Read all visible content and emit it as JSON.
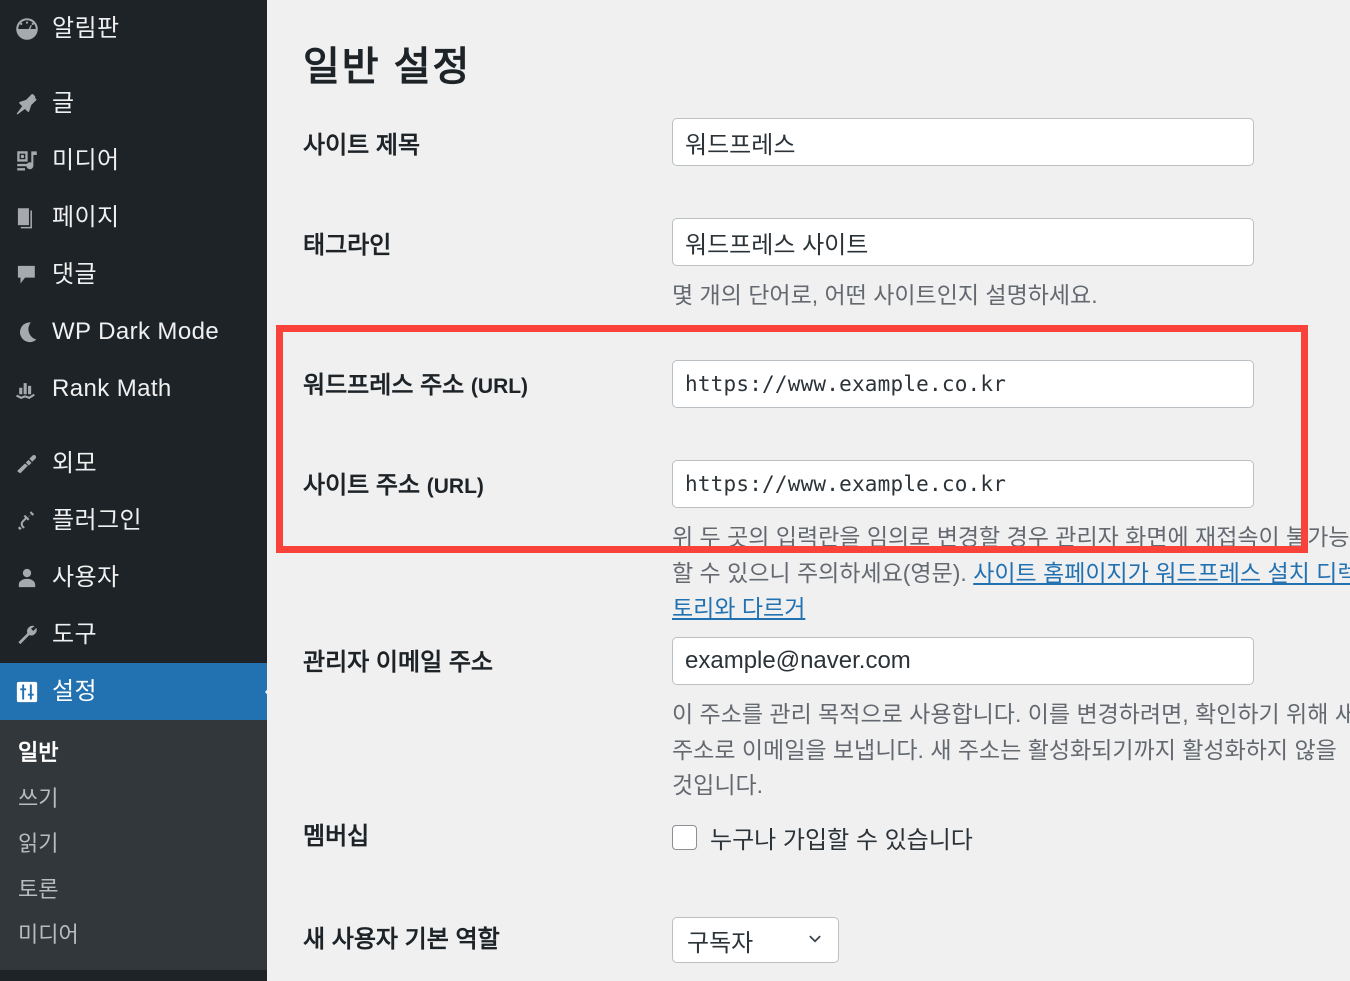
{
  "colors": {
    "sidebar_bg": "#1d2327",
    "submenu_bg": "#32373c",
    "accent_blue": "#2271b1",
    "link_blue": "#2271b1",
    "content_bg": "#f0f0f1",
    "annotation_red": "#f9423a",
    "text_dark": "#1d2327",
    "text_muted": "#646970"
  },
  "sidebar": {
    "items": [
      {
        "label": "알림판",
        "icon": "dashboard-icon",
        "current": false
      },
      {
        "label": "글",
        "icon": "pin-icon",
        "current": false
      },
      {
        "label": "미디어",
        "icon": "media-icon",
        "current": false
      },
      {
        "label": "페이지",
        "icon": "pages-icon",
        "current": false
      },
      {
        "label": "댓글",
        "icon": "comment-icon",
        "current": false
      },
      {
        "label": "WP Dark Mode",
        "icon": "moon-icon",
        "current": false
      },
      {
        "label": "Rank Math",
        "icon": "chart-bars-icon",
        "current": false
      },
      {
        "label": "외모",
        "icon": "paintbrush-icon",
        "current": false
      },
      {
        "label": "플러그인",
        "icon": "plug-icon",
        "current": false
      },
      {
        "label": "사용자",
        "icon": "user-icon",
        "current": false
      },
      {
        "label": "도구",
        "icon": "wrench-icon",
        "current": false
      },
      {
        "label": "설정",
        "icon": "settings-sliders-icon",
        "current": true
      }
    ],
    "submenu": [
      {
        "label": "일반",
        "current": true
      },
      {
        "label": "쓰기",
        "current": false
      },
      {
        "label": "읽기",
        "current": false
      },
      {
        "label": "토론",
        "current": false
      },
      {
        "label": "미디어",
        "current": false
      }
    ]
  },
  "page": {
    "title": "일반 설정"
  },
  "fields": {
    "site_title": {
      "label": "사이트 제목",
      "value": "워드프레스"
    },
    "tagline": {
      "label": "태그라인",
      "value": "워드프레스 사이트",
      "description": "몇 개의 단어로, 어떤 사이트인지 설명하세요."
    },
    "wp_address": {
      "label_main": "워드프레스 주소",
      "label_suffix": "(URL)",
      "value": "https://www.example.co.kr"
    },
    "site_address": {
      "label_main": "사이트 주소",
      "label_suffix": "(URL)",
      "value": "https://www.example.co.kr",
      "description_text": "위 두 곳의 입력란을 임의로 변경할 경우 관리자 화면에 재접속이 불가능할 수 있으니 주의하세요(영문). ",
      "description_link": "사이트 홈페이지가 워드프레스 설치 디렉토리와 다르거"
    },
    "admin_email": {
      "label": "관리자 이메일 주소",
      "value": "example@naver.com",
      "description": "이 주소를 관리 목적으로 사용합니다. 이를 변경하려면, 확인하기 위해 새 주소로 이메일을 보냅니다. 새 주소는 활성화되기까지 활성화하지 않을 것입니다."
    },
    "membership": {
      "label": "멤버십",
      "checkbox_label": "누구나 가입할 수 있습니다",
      "checked": false
    },
    "default_role": {
      "label": "새 사용자 기본 역할",
      "value": "구독자",
      "options": [
        "구독자"
      ]
    }
  },
  "annotation": {
    "kind": "red-highlight-rectangle",
    "targets": [
      "워드프레스 주소 (URL)",
      "사이트 주소 (URL)"
    ]
  }
}
